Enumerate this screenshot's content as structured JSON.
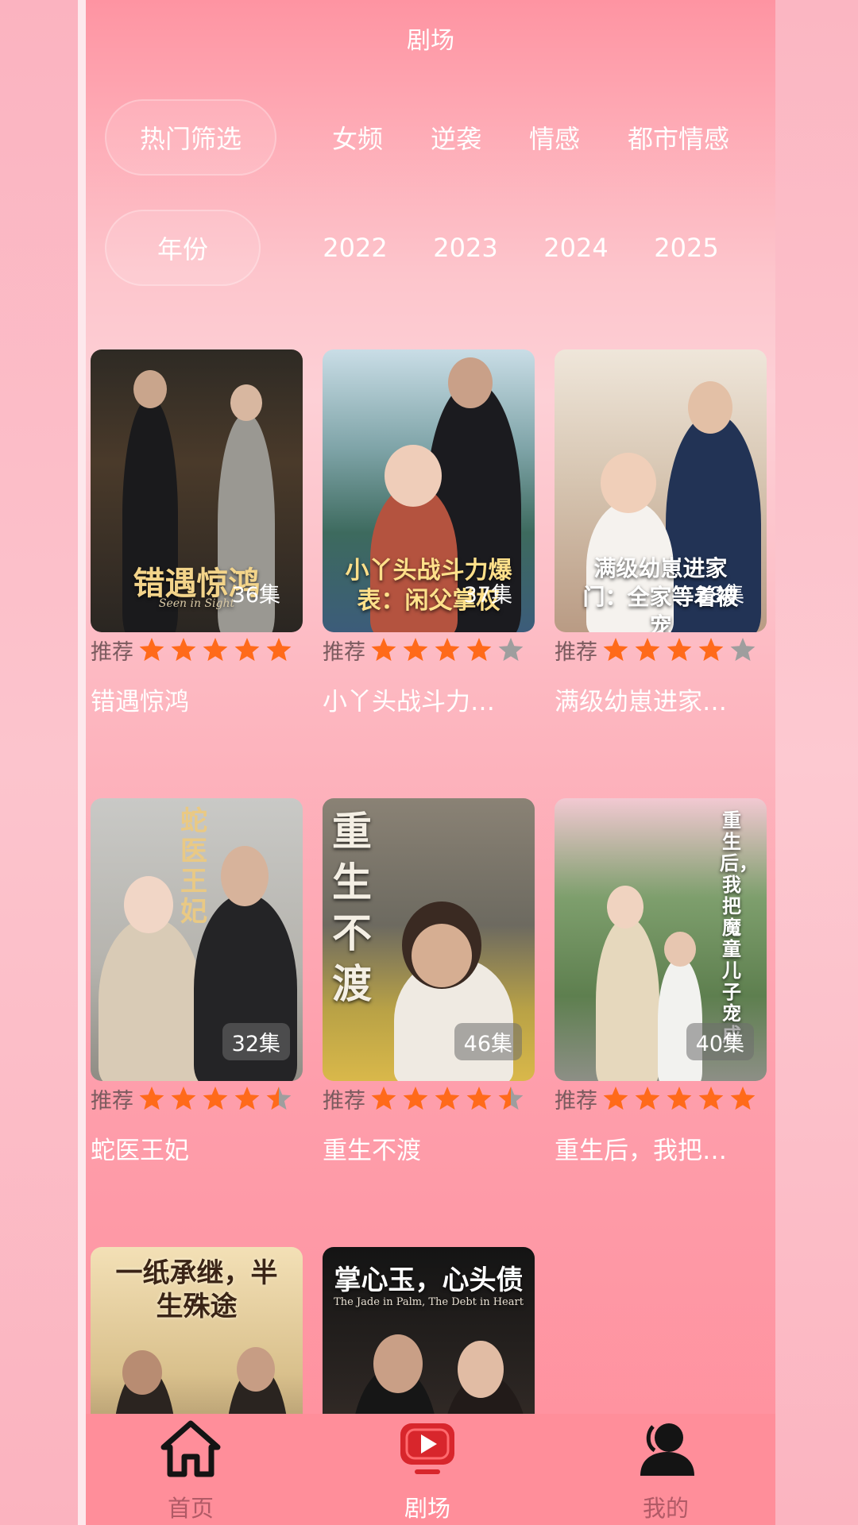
{
  "header": {
    "title": "剧场"
  },
  "filters": {
    "hot": {
      "label": "热门筛选",
      "options": [
        "女频",
        "逆袭",
        "情感",
        "都市情感"
      ]
    },
    "year": {
      "label": "年份",
      "options": [
        "2022",
        "2023",
        "2024",
        "2025"
      ]
    }
  },
  "dramas": [
    {
      "name": "错遇惊鸿",
      "episodes": "36集",
      "rating_label": "推荐",
      "stars": 5,
      "poster_text": "错遇惊鸿",
      "poster_sub": "Seen in Sight"
    },
    {
      "name": "小丫头战斗力…",
      "episodes": "37集",
      "rating_label": "推荐",
      "stars": 4,
      "poster_text": "小丫头战斗力爆表：闲父掌权"
    },
    {
      "name": "满级幼崽进家…",
      "episodes": "38集",
      "rating_label": "推荐",
      "stars": 4,
      "poster_text": "满级幼崽进家门：全家等着被宠"
    },
    {
      "name": "蛇医王妃",
      "episodes": "32集",
      "rating_label": "推荐",
      "stars": 4.5,
      "poster_text": "蛇医王妃"
    },
    {
      "name": "重生不渡",
      "episodes": "46集",
      "rating_label": "推荐",
      "stars": 4.5,
      "poster_text": "重生不渡"
    },
    {
      "name": "重生后，我把…",
      "episodes": "40集",
      "rating_label": "推荐",
      "stars": 5,
      "poster_text": "重生后，我把魔童儿子宠成"
    },
    {
      "name": "",
      "episodes": "",
      "rating_label": "",
      "stars": 0,
      "poster_text": "一纸承继，半生殊途"
    },
    {
      "name": "",
      "episodes": "",
      "rating_label": "",
      "stars": 0,
      "poster_text": "掌心玉，心头债",
      "poster_sub": "The Jade in Palm, The Debt in Heart"
    }
  ],
  "tabbar": {
    "items": [
      {
        "label": "首页",
        "icon": "home-icon",
        "active": false
      },
      {
        "label": "剧场",
        "icon": "play-video-icon",
        "active": true
      },
      {
        "label": "我的",
        "icon": "user-profile-icon",
        "active": false
      }
    ]
  },
  "colors": {
    "star_full": "#ff6a1a",
    "star_empty": "#9e9e9e",
    "tab_active": "#ffffff",
    "tab_inactive": "#b05a66",
    "tab_active_icon": "#d8262c"
  }
}
